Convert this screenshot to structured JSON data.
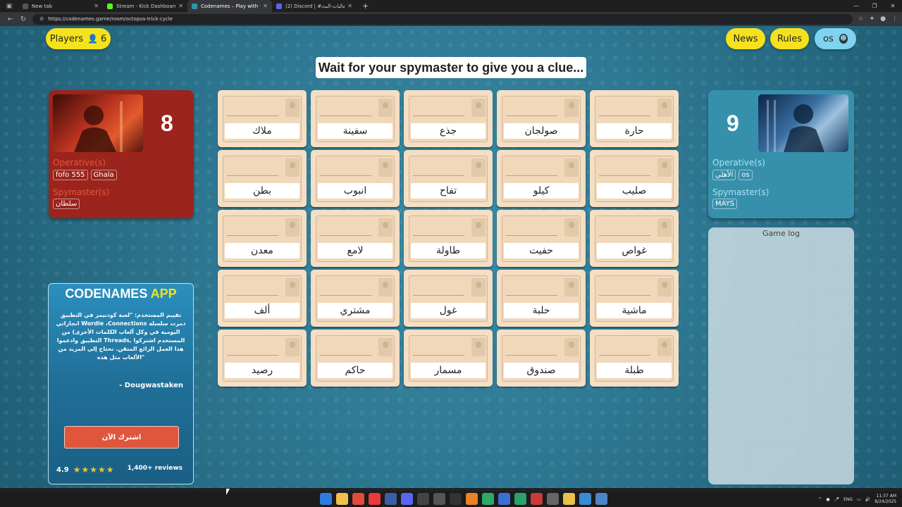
{
  "browser": {
    "tabs": [
      {
        "label": "New tab",
        "color": "#555555",
        "active": false
      },
      {
        "label": "Stream - Kick Dashboard",
        "color": "#53fc18",
        "active": false
      },
      {
        "label": "Codenames – Play with your Frien",
        "color": "#3790ab",
        "active": true
      },
      {
        "label": "(2) Discord | #فعاليات-البث |",
        "color": "#5865f2",
        "active": false
      }
    ],
    "url": "https://codenames.game/room/octopus-trick-cycle"
  },
  "top": {
    "players_label": "Players",
    "players_count": "6",
    "news_label": "News",
    "rules_label": "Rules",
    "user_label": "os"
  },
  "status": "Wait for your spymaster to give you a clue...",
  "red_team": {
    "score": "8",
    "operatives_label": "Operative(s)",
    "operatives": [
      "fofo 555",
      "Ghala"
    ],
    "spymasters_label": "Spymaster(s)",
    "spymasters": [
      "سلطان"
    ]
  },
  "blue_team": {
    "score": "9",
    "operatives_label": "Operative(s)",
    "operatives": [
      "الأهلي",
      "os"
    ],
    "spymasters_label": "Spymaster(s)",
    "spymasters": [
      "MAYS"
    ]
  },
  "board": {
    "cards": [
      "ملاك",
      "سفينة",
      "جذع",
      "صولجان",
      "حارة",
      "بطن",
      "انبوب",
      "تفاح",
      "كيلو",
      "صليب",
      "معدن",
      "لامع",
      "طاولة",
      "حفيت",
      "غواص",
      "ألف",
      "مشتري",
      "غول",
      "حلبة",
      "ماشية",
      "رصيد",
      "حاكم",
      "مسمار",
      "صندوق",
      "طبلة"
    ]
  },
  "game_log": {
    "title": "Game log"
  },
  "ad": {
    "title_main": "CODENAMES",
    "title_app": "APP",
    "quote": "تقييم المستخدم: \"لعبة كودنيمز في التطبيق دمرت سلسلة Wordle ،Connections انجازاتي اليومية في وكل ألعاب الكلمات الأخرى) من المستخدم اشتركوا ,Threads التطبيق وادعموا هذا العمل الرائع المتقن. نحتاج إلى المزيد من \"الألعاب مثل هذه",
    "author": "- Dougwastaken",
    "cta": "اشترك الآن",
    "rating": "4.9",
    "stars": "★★★★★",
    "reviews": "1,400+ reviews"
  },
  "taskbar": {
    "lang": "ENG",
    "time": "11:37 AM",
    "date": "8/24/2025"
  }
}
